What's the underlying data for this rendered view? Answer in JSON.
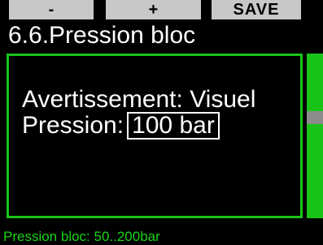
{
  "softkeys": {
    "left_label": "-",
    "middle_label": "+",
    "right_label": "SAVE"
  },
  "header": {
    "title": "6.6.Pression bloc"
  },
  "settings": {
    "warning_label": "Avertissement:",
    "warning_value": "Visuel",
    "pressure_label": "Pression:",
    "pressure_value": "100 bar"
  },
  "footer": {
    "hint": "Pression bloc: 50..200bar"
  },
  "scrollbar": {
    "position": 0.38
  },
  "colors": {
    "accent_green": "#19c419",
    "softkey_bg": "#c8c8c8",
    "background": "#000000",
    "text": "#ffffff",
    "scroll_thumb": "#8c8c8c"
  }
}
